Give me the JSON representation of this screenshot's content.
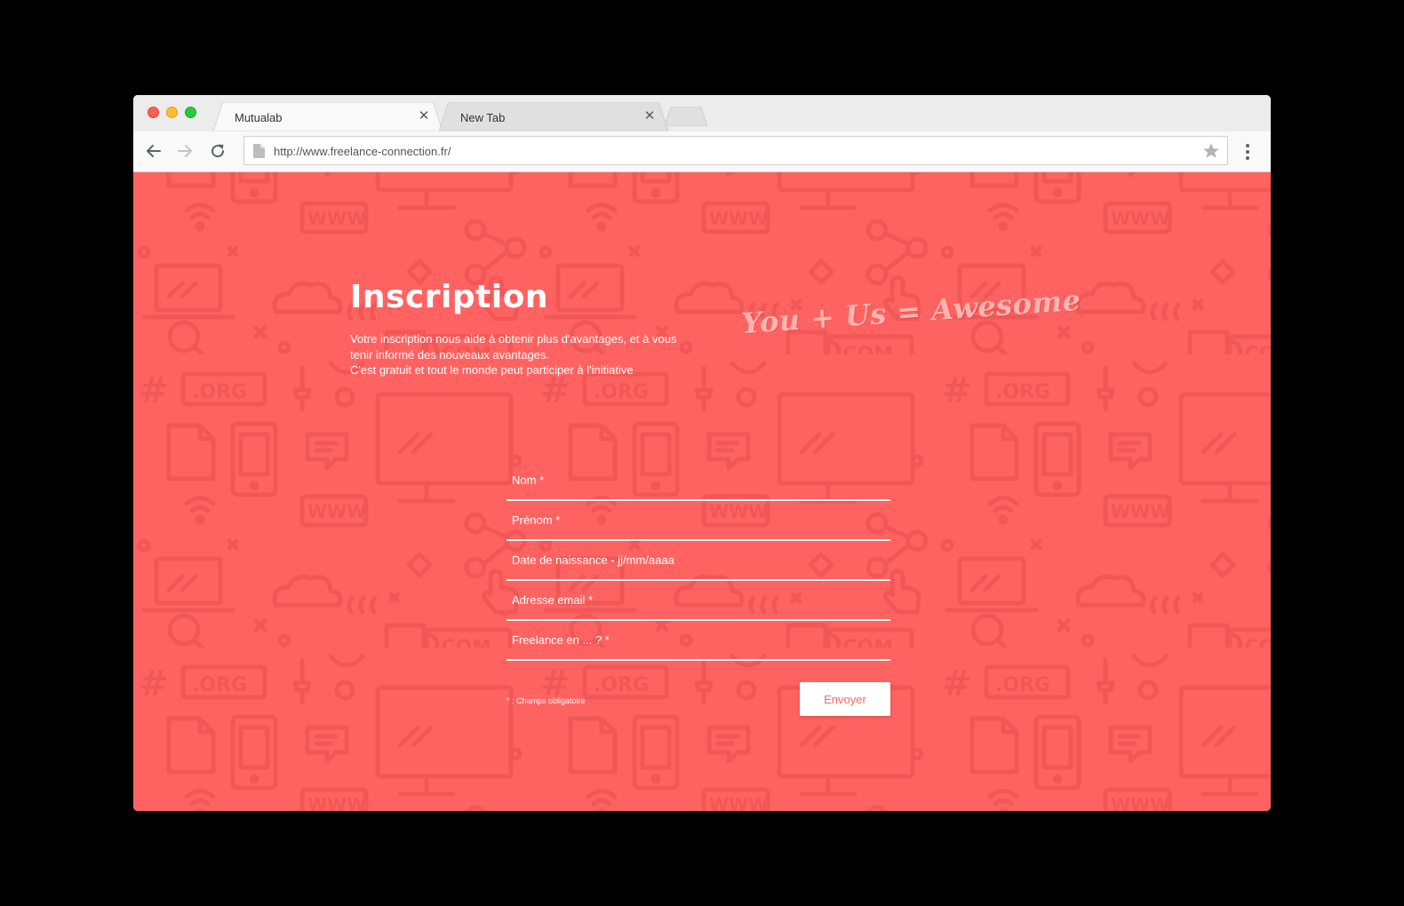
{
  "browser": {
    "tabs": [
      {
        "label": "Mutualab",
        "active": true
      },
      {
        "label": "New Tab",
        "active": false
      }
    ],
    "url": "http://www.freelance-connection.fr/",
    "icons": {
      "back": "arrow-left-icon",
      "forward": "arrow-right-icon",
      "reload": "reload-icon",
      "bookmark": "star-icon",
      "menu": "more-vertical-icon",
      "page": "page-icon",
      "close": "close-icon"
    }
  },
  "page": {
    "title": "Inscription",
    "description": [
      "Votre inscription nous aide à obtenir plus d'avantages, et à vous",
      "tenir informé des nouveaux avantages.",
      "C'est gratuit et tout le monde peut participer à l'initiative"
    ],
    "tagline": "You + Us = Awesome",
    "background_color": "#ff6361",
    "form": {
      "fields": [
        {
          "label": "Nom *"
        },
        {
          "label": "Prénom *"
        },
        {
          "label": "Date de naissance - jj/mm/aaaa"
        },
        {
          "label": "Adresse email *"
        },
        {
          "label": "Freelance en ... ? *"
        }
      ],
      "required_note": "* : Champs obligatoire",
      "submit_label": "Envoyer"
    },
    "pattern_labels": {
      "org": ".ORG",
      "com": ".COM",
      "www": "WWW",
      "hash": "#"
    }
  }
}
